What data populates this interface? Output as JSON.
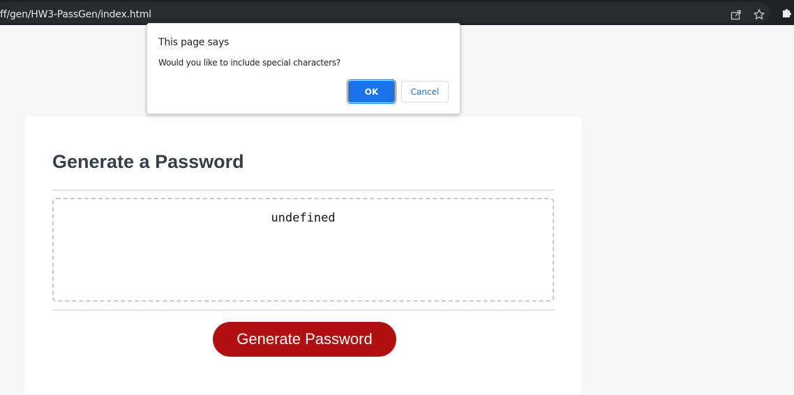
{
  "browser": {
    "url": "ff/gen/HW3-PassGen/index.html",
    "icons": [
      "share-icon",
      "star-icon",
      "puzzle-icon"
    ]
  },
  "dialog": {
    "title": "This page says",
    "message": "Would you like to include special characters?",
    "ok_label": "OK",
    "cancel_label": "Cancel"
  },
  "card": {
    "title": "Generate a Password",
    "password_value": "undefined",
    "generate_label": "Generate Password"
  },
  "colors": {
    "accent": "#1a73e8",
    "generate_button": "#b11010",
    "heading": "#353f4b"
  }
}
